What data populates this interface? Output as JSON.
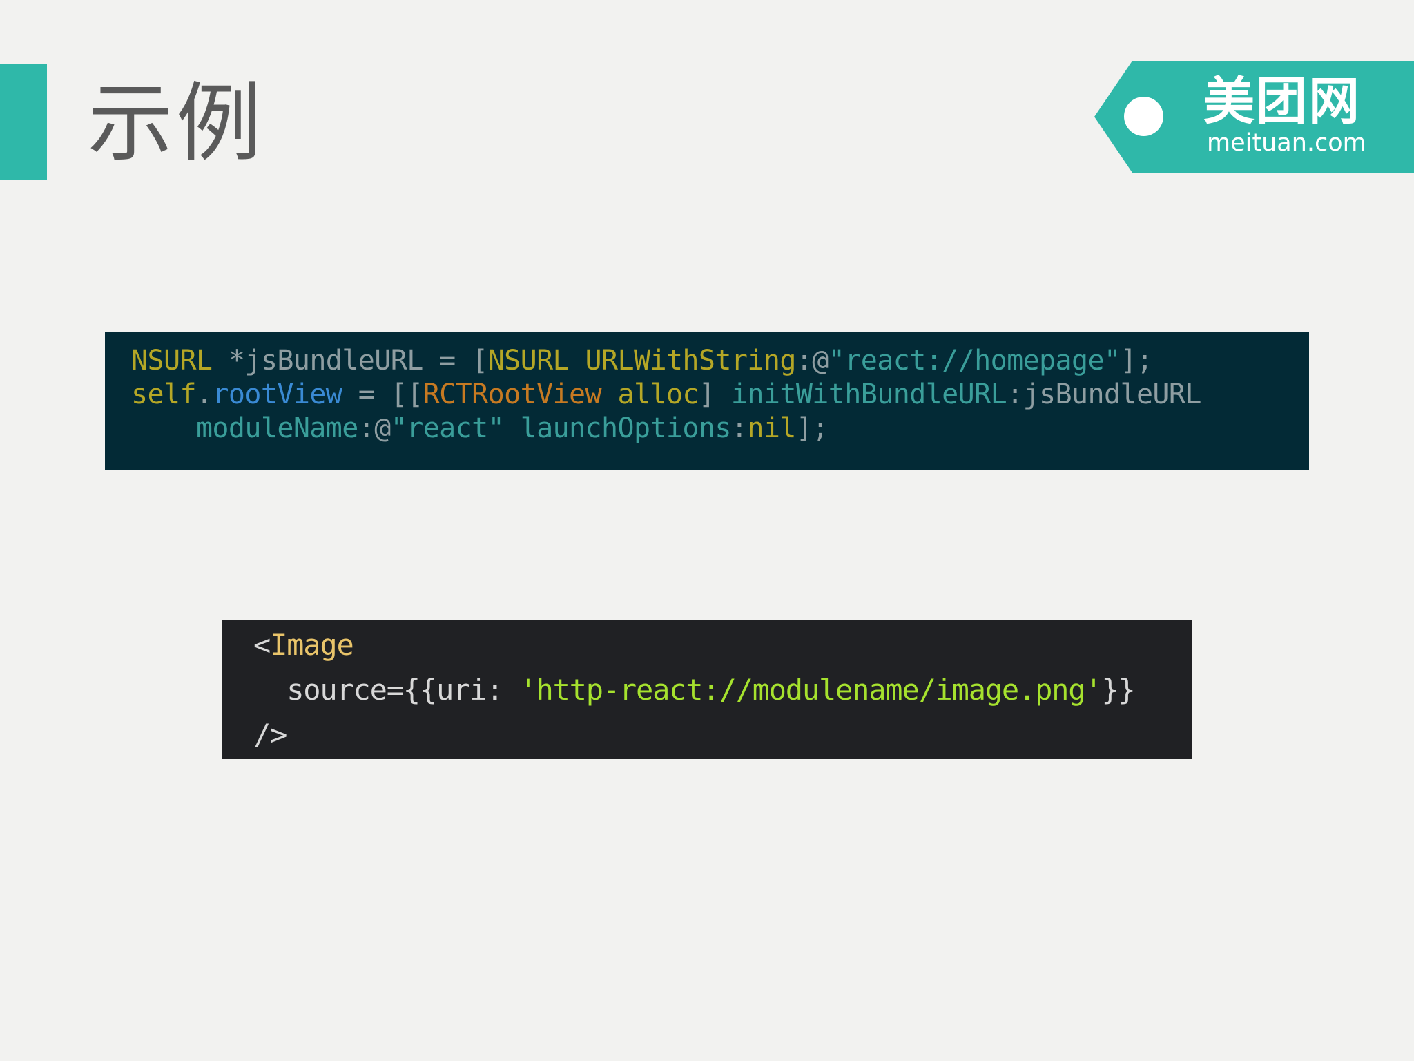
{
  "slide": {
    "title": "示例"
  },
  "logo": {
    "cn_text": "美团网",
    "en_text": "meituan.com",
    "brand_color": "#2fb8a9"
  },
  "colors": {
    "background": "#f2f2f0",
    "objc_background": "#032a36",
    "jsx_background": "#202124"
  },
  "objc_code": {
    "line1": {
      "t1": "NSURL",
      "t2": " *jsBundleURL = [",
      "t3": "NSURL",
      "t4": " ",
      "t5": "URLWithString",
      "t6": ":@",
      "t7": "\"react://homepage\"",
      "t8": "];"
    },
    "line2": {
      "t1": "self",
      "t2": ".",
      "t3": "rootView",
      "t4": " = [[",
      "t5": "RCTRootView",
      "t6": " ",
      "t7": "alloc",
      "t8": "] ",
      "t9": "initWithBundleURL",
      "t10": ":jsBundleURL"
    },
    "line3": {
      "indent": "    ",
      "t1": "moduleName",
      "t2": ":@",
      "t3": "\"react\"",
      "t4": " ",
      "t5": "launchOptions",
      "t6": ":",
      "t7": "nil",
      "t8": "];"
    }
  },
  "jsx_code": {
    "line1": {
      "open": "<",
      "tag": "Image"
    },
    "line2": {
      "indent": "  ",
      "attr": "source={{uri: ",
      "value": "'http-react://modulename/image.png'",
      "close": "}}"
    },
    "line3": {
      "close_tag": "/>"
    }
  }
}
